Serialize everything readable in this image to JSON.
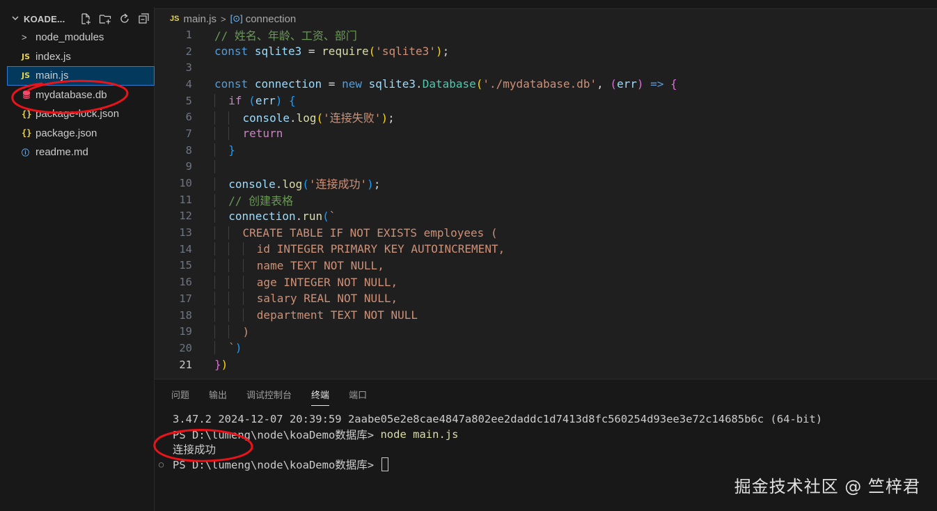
{
  "sidebar": {
    "title": "KOADE...",
    "actions": [
      "new-file-icon",
      "new-folder-icon",
      "refresh-icon",
      "collapse-all-icon"
    ],
    "items": [
      {
        "label": "node_modules",
        "icon": "folder-chevron-icon",
        "icon_text": ">"
      },
      {
        "label": "index.js",
        "icon": "js-file-icon",
        "icon_text": "JS"
      },
      {
        "label": "main.js",
        "icon": "js-file-icon",
        "icon_text": "JS",
        "active": true
      },
      {
        "label": "mydatabase.db",
        "icon": "database-icon",
        "icon_text": ""
      },
      {
        "label": "package-lock.json",
        "icon": "json-file-icon",
        "icon_text": "{}"
      },
      {
        "label": "package.json",
        "icon": "json-file-icon",
        "icon_text": "{}"
      },
      {
        "label": "readme.md",
        "icon": "info-icon",
        "icon_text": "ⓘ"
      }
    ]
  },
  "editor": {
    "breadcrumb": {
      "file_icon": "JS",
      "file": "main.js",
      "separator": ">",
      "symbol": "connection"
    },
    "current_line": 21,
    "lines": [
      {
        "n": "1"
      },
      {
        "n": "2"
      },
      {
        "n": "3"
      },
      {
        "n": "4"
      },
      {
        "n": "5"
      },
      {
        "n": "6"
      },
      {
        "n": "7"
      },
      {
        "n": "8"
      },
      {
        "n": "9"
      },
      {
        "n": "10"
      },
      {
        "n": "11"
      },
      {
        "n": "12"
      },
      {
        "n": "13"
      },
      {
        "n": "14"
      },
      {
        "n": "15"
      },
      {
        "n": "16"
      },
      {
        "n": "17"
      },
      {
        "n": "18"
      },
      {
        "n": "19"
      },
      {
        "n": "20"
      },
      {
        "n": "21"
      }
    ],
    "code": {
      "l1": "// 姓名、年龄、工资、部门",
      "l2_kw": "const",
      "l2_var": "sqlite3",
      "l2_eq": "=",
      "l2_fn": "require",
      "l2_str": "'sqlite3'",
      "l4_kw": "const",
      "l4_var": "connection",
      "l4_eq": "=",
      "l4_new": "new",
      "l4_obj": "sqlite3",
      "l4_cls": "Database",
      "l4_str": "'./mydatabase.db'",
      "l4_param": "err",
      "l4_arrow": "=>",
      "l5_kw": "if",
      "l5_var": "err",
      "l6_obj": "console",
      "l6_fn": "log",
      "l6_str": "'连接失败'",
      "l7_kw": "return",
      "l10_obj": "console",
      "l10_fn": "log",
      "l10_str": "'连接成功'",
      "l11": "// 创建表格",
      "l12_obj": "connection",
      "l12_fn": "run",
      "l12_tick": "`",
      "l13": "CREATE TABLE IF NOT EXISTS employees (",
      "l14": "id INTEGER PRIMARY KEY AUTOINCREMENT,",
      "l15": "name TEXT NOT NULL,",
      "l16": "age INTEGER NOT NULL,",
      "l17": "salary REAL NOT NULL,",
      "l18": "department TEXT NOT NULL",
      "l19": ")",
      "l20": "`"
    }
  },
  "panel": {
    "tabs": [
      {
        "label": "问题"
      },
      {
        "label": "输出"
      },
      {
        "label": "调试控制台"
      },
      {
        "label": "终端",
        "active": true
      },
      {
        "label": "端口"
      }
    ],
    "terminal": {
      "line1": "3.47.2 2024-12-07 20:39:59 2aabe05e2e8cae4847a802ee2daddc1d7413d8fc560254d93ee3e72c14685b6c (64-bit)",
      "line2_prompt": "PS D:\\lumeng\\node\\koaDemo数据库> ",
      "line2_cmd": "node main.js",
      "line3": "连接成功",
      "line4_prompt": "PS D:\\lumeng\\node\\koaDemo数据库> "
    }
  },
  "watermark": "掘金技术社区 @ 竺梓君",
  "colors": {
    "annotation": "#e8141a",
    "accent": "#2b7bd1",
    "js_icon": "#e8d44d"
  }
}
